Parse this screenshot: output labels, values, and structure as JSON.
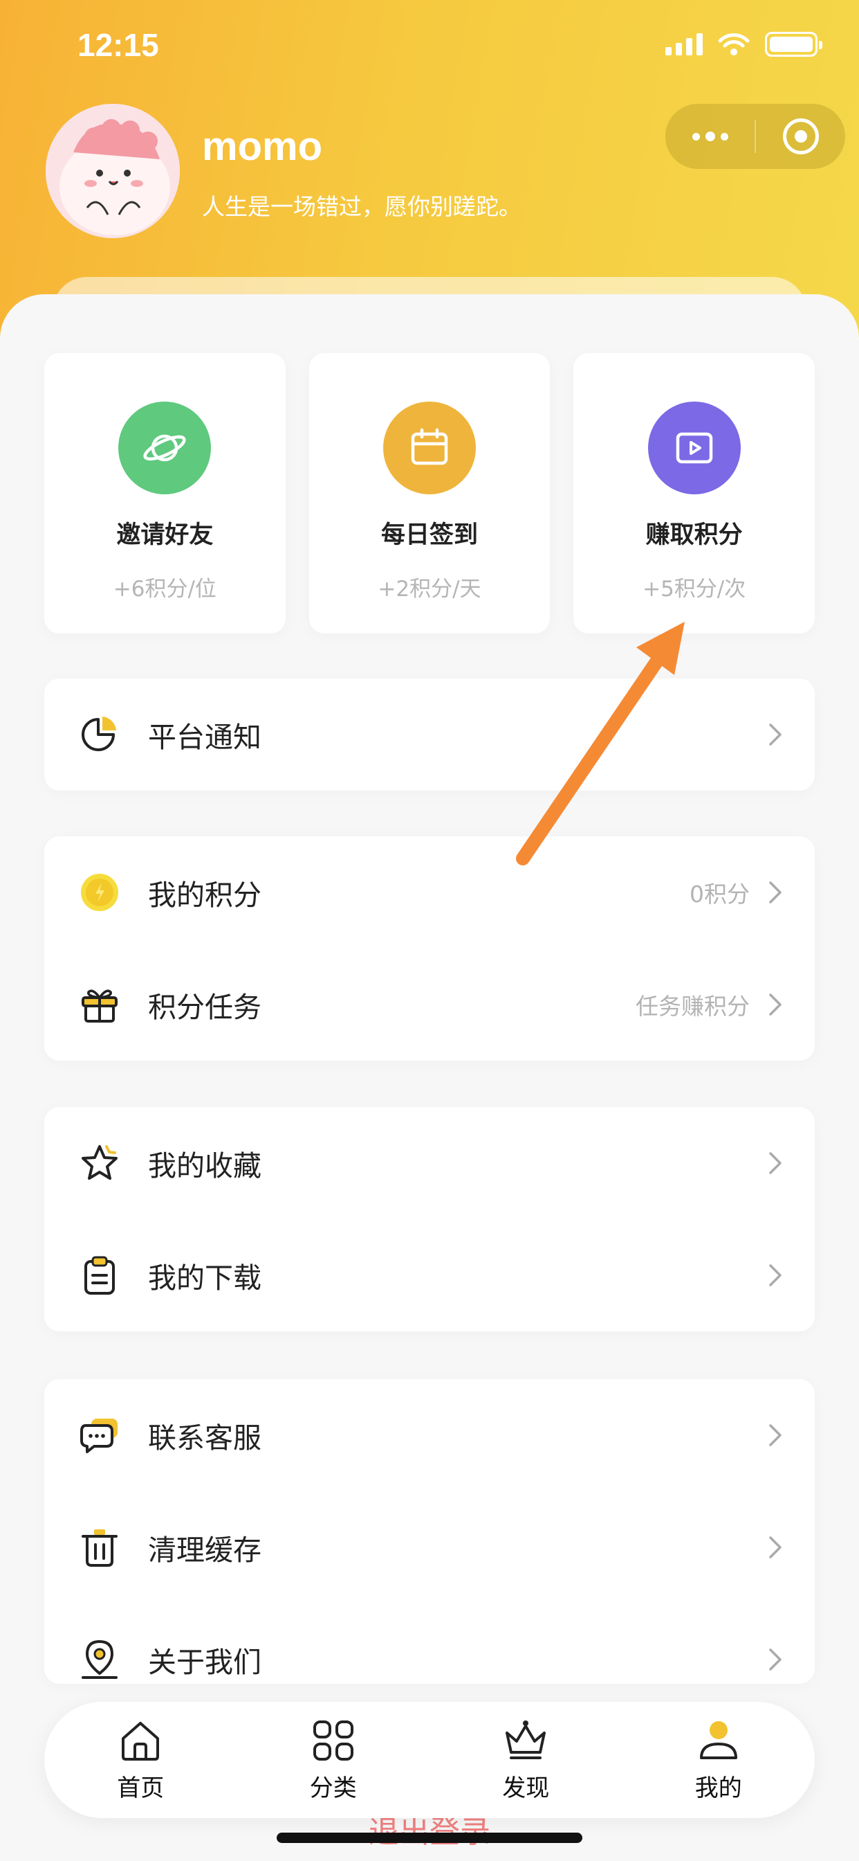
{
  "status_bar": {
    "time": "12:15"
  },
  "profile": {
    "username": "momo",
    "bio": "人生是一场错过，愿你别蹉跎。"
  },
  "feature_cards": [
    {
      "title": "邀请好友",
      "subtitle": "+6积分/位",
      "icon": "planet-icon",
      "color": "#5fc97e"
    },
    {
      "title": "每日签到",
      "subtitle": "+2积分/天",
      "icon": "calendar-icon",
      "color": "#efb43c"
    },
    {
      "title": "赚取积分",
      "subtitle": "+5积分/次",
      "icon": "video-play-icon",
      "color": "#7b69e6"
    }
  ],
  "menu": {
    "notice": {
      "label": "平台通知"
    },
    "points": {
      "label": "我的积分",
      "value": "0积分"
    },
    "tasks": {
      "label": "积分任务",
      "value": "任务赚积分"
    },
    "favorites": {
      "label": "我的收藏"
    },
    "downloads": {
      "label": "我的下载"
    },
    "support": {
      "label": "联系客服"
    },
    "cache": {
      "label": "清理缓存"
    },
    "about": {
      "label": "关于我们"
    }
  },
  "logout_label": "退出登录",
  "tabbar": [
    {
      "label": "首页",
      "icon": "home-icon"
    },
    {
      "label": "分类",
      "icon": "grid-icon"
    },
    {
      "label": "发现",
      "icon": "crown-icon"
    },
    {
      "label": "我的",
      "icon": "user-icon"
    }
  ],
  "colors": {
    "header_gradient_start": "#f7b235",
    "header_gradient_end": "#f5d84a",
    "accent_yellow": "#f2c230",
    "arrow_orange": "#f58a35",
    "logout_red": "#f08080"
  }
}
